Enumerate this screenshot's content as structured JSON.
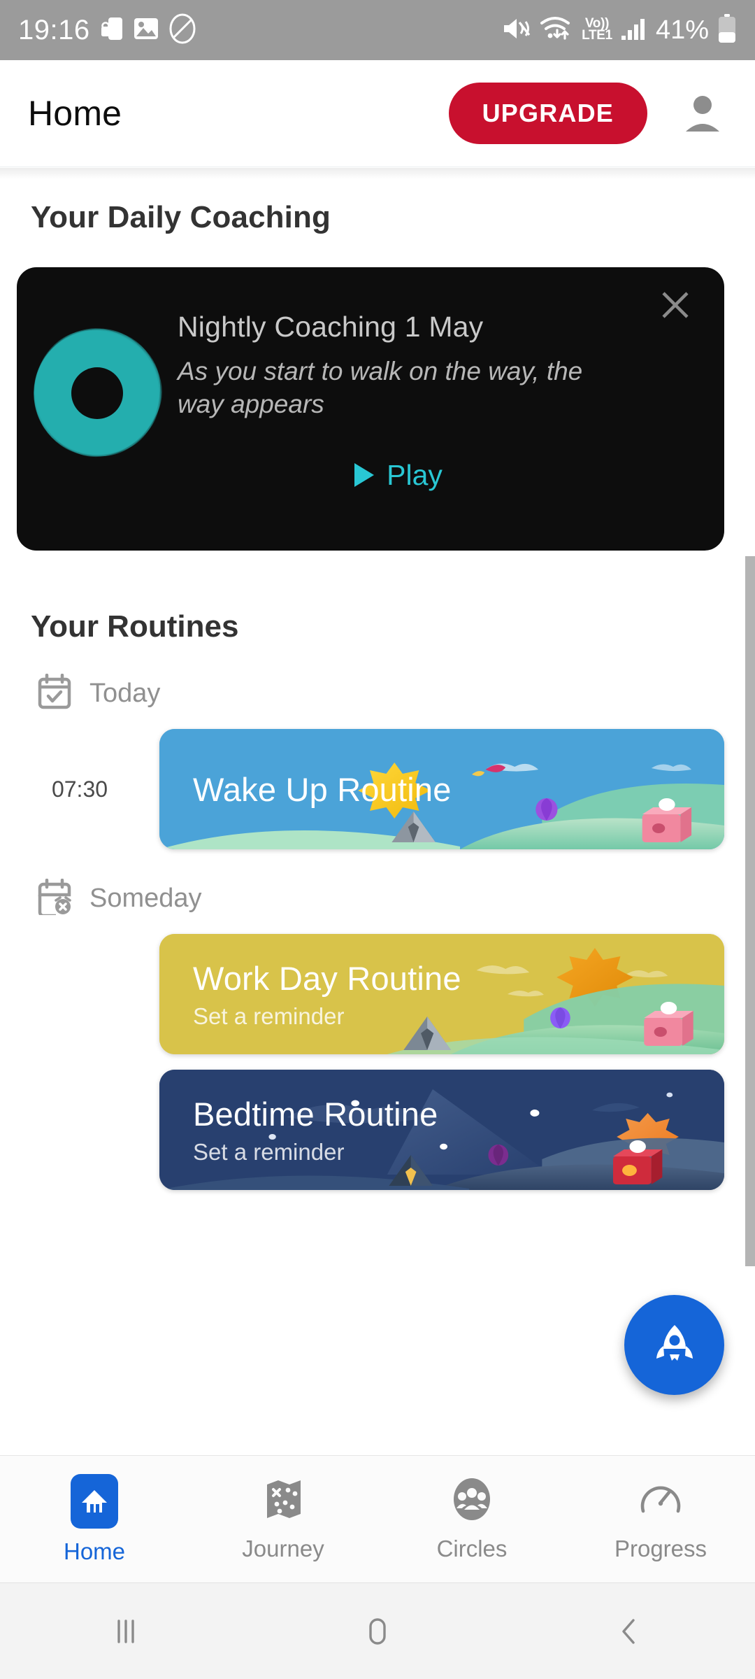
{
  "status_bar": {
    "time": "19:16",
    "battery_percent": "41%",
    "network": {
      "voice": "Vo))",
      "tech": "LTE1"
    },
    "icons": [
      "lock-phone-icon",
      "image-icon",
      "no-sim-circle-slash-icon",
      "mute-icon",
      "wifi-icon",
      "signal-bars-icon",
      "battery-icon"
    ]
  },
  "app_bar": {
    "title": "Home",
    "upgrade_label": "UPGRADE",
    "avatar_icon": "person-icon"
  },
  "daily_coaching": {
    "section_title": "Your Daily Coaching",
    "card": {
      "title": "Nightly Coaching 1 May",
      "subtitle": "As you start to walk on the way, the way appears",
      "play_label": "Play",
      "close_icon": "close-icon",
      "thumbnail_icon": "teal-donut-icon",
      "background": "#0d0d0d",
      "accent": "#29c7d4"
    }
  },
  "routines": {
    "section_title": "Your Routines",
    "groups": [
      {
        "label": "Today",
        "icon": "calendar-check-icon",
        "items": [
          {
            "time": "07:30",
            "title": "Wake Up Routine",
            "subtitle": "",
            "theme": "day",
            "color": "#4ba3d8"
          }
        ]
      },
      {
        "label": "Someday",
        "icon": "calendar-alarm-off-icon",
        "items": [
          {
            "time": "",
            "title": "Work Day Routine",
            "subtitle": "Set a reminder",
            "theme": "noon",
            "color": "#d8c34a"
          },
          {
            "time": "",
            "title": "Bedtime Routine",
            "subtitle": "Set a reminder",
            "theme": "night",
            "color": "#28406f"
          }
        ]
      }
    ]
  },
  "fab": {
    "icon": "rocket-icon",
    "color": "#1565d8"
  },
  "bottom_nav": {
    "active_index": 0,
    "items": [
      {
        "label": "Home",
        "icon": "home-icon"
      },
      {
        "label": "Journey",
        "icon": "map-icon"
      },
      {
        "label": "Circles",
        "icon": "people-group-icon"
      },
      {
        "label": "Progress",
        "icon": "gauge-icon"
      }
    ]
  },
  "android_nav": {
    "items": [
      {
        "icon": "recents-icon"
      },
      {
        "icon": "home-pill-icon"
      },
      {
        "icon": "back-chevron-icon"
      }
    ]
  }
}
